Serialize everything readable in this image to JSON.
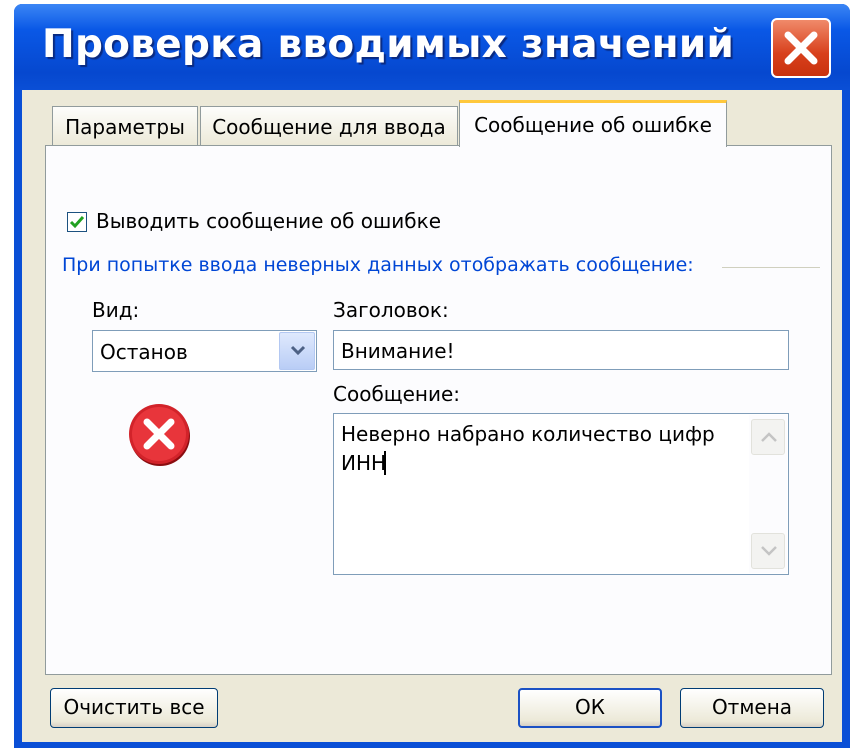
{
  "window": {
    "title": "Проверка вводимых значений",
    "close_icon": "close-x-icon"
  },
  "tabs": [
    {
      "label": "Параметры",
      "active": false
    },
    {
      "label": "Сообщение для ввода",
      "active": false
    },
    {
      "label": "Сообщение об ошибке",
      "active": true
    }
  ],
  "error_tab": {
    "show_error_checkbox": {
      "label": "Выводить сообщение об ошибке",
      "checked": true
    },
    "group_label": "При попытке ввода неверных данных отображать сообщение:",
    "style": {
      "label": "Вид:",
      "selected": "Останов",
      "icon": "stop-error-icon"
    },
    "title_field": {
      "label": "Заголовок:",
      "value": "Внимание!"
    },
    "message_field": {
      "label": "Сообщение:",
      "value": "Неверно набрано количество цифр\nИНН"
    }
  },
  "buttons": {
    "clear_all": "Очистить все",
    "ok": "ОК",
    "cancel": "Отмена"
  },
  "colors": {
    "title_bar": "#0a4fd6",
    "accent_tab": "#ffc83c",
    "group_label": "#0046d5",
    "stop_icon": "#d2232a",
    "close_button": "#d8401c"
  }
}
